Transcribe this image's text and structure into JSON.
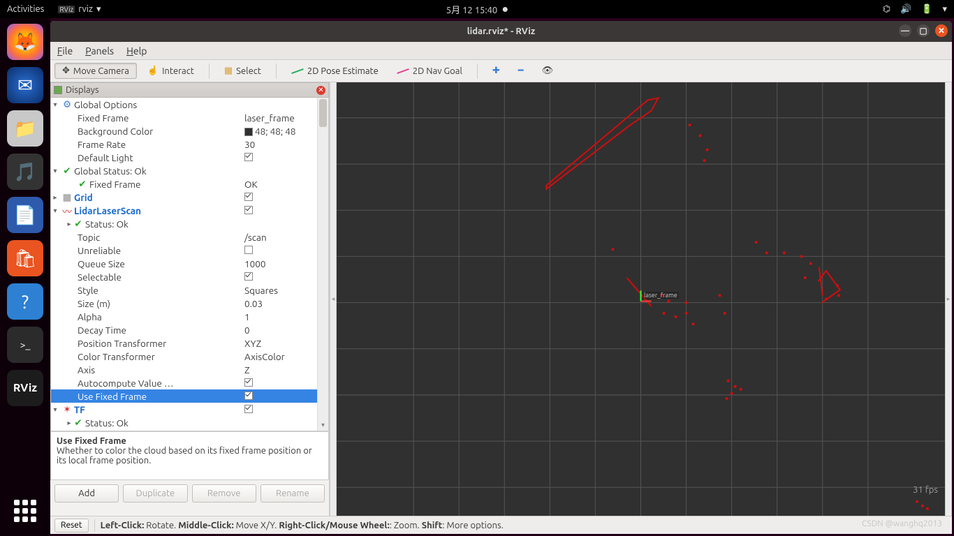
{
  "gnome": {
    "activities": "Activities",
    "app_label": "rviz",
    "app_brand": "RViz",
    "caret": "▾",
    "datetime": "5月 12  15:40"
  },
  "window": {
    "title": "lidar.rviz* - RViz"
  },
  "menu": {
    "file": "File",
    "panels": "Panels",
    "help": "Help"
  },
  "toolbar": {
    "move_camera": "Move Camera",
    "interact": "Interact",
    "select": "Select",
    "pose_estimate": "2D Pose Estimate",
    "nav_goal": "2D Nav Goal"
  },
  "displays": {
    "title": "Displays",
    "global_options": "Global Options",
    "fixed_frame": {
      "name": "Fixed Frame",
      "value": "laser_frame"
    },
    "bg_color": {
      "name": "Background Color",
      "value": "48; 48; 48"
    },
    "frame_rate": {
      "name": "Frame Rate",
      "value": "30"
    },
    "default_light": {
      "name": "Default Light"
    },
    "global_status": "Global Status: Ok",
    "ff_status": {
      "name": "Fixed Frame",
      "value": "OK"
    },
    "grid": "Grid",
    "laser": "LidarLaserScan",
    "status_ok": "Status: Ok",
    "topic": {
      "name": "Topic",
      "value": "/scan"
    },
    "unreliable": {
      "name": "Unreliable"
    },
    "queue": {
      "name": "Queue Size",
      "value": "1000"
    },
    "selectable": {
      "name": "Selectable"
    },
    "style": {
      "name": "Style",
      "value": "Squares"
    },
    "size": {
      "name": "Size (m)",
      "value": "0.03"
    },
    "alpha": {
      "name": "Alpha",
      "value": "1"
    },
    "decay": {
      "name": "Decay Time",
      "value": "0"
    },
    "postrans": {
      "name": "Position Transformer",
      "value": "XYZ"
    },
    "colortrans": {
      "name": "Color Transformer",
      "value": "AxisColor"
    },
    "axis": {
      "name": "Axis",
      "value": "Z"
    },
    "autocomp": {
      "name": "Autocompute Value …"
    },
    "use_fixed": {
      "name": "Use Fixed Frame"
    },
    "tf": "TF",
    "tf_status": "Status: Ok"
  },
  "desc": {
    "title": "Use Fixed Frame",
    "body": "Whether to color the cloud based on its fixed frame position or its local frame position."
  },
  "buttons": {
    "add": "Add",
    "dup": "Duplicate",
    "rem": "Remove",
    "ren": "Rename",
    "reset": "Reset"
  },
  "status": {
    "text1": "Left-Click:",
    "text1b": " Rotate. ",
    "text2": "Middle-Click:",
    "text2b": " Move X/Y. ",
    "text3": "Right-Click/Mouse Wheel:",
    "text3b": ": Zoom. ",
    "text4": "Shift",
    "text4b": ": More options."
  },
  "fps": "31 fps",
  "watermark": "CSDN @wanghq2013",
  "axis_label": "laser_frame"
}
